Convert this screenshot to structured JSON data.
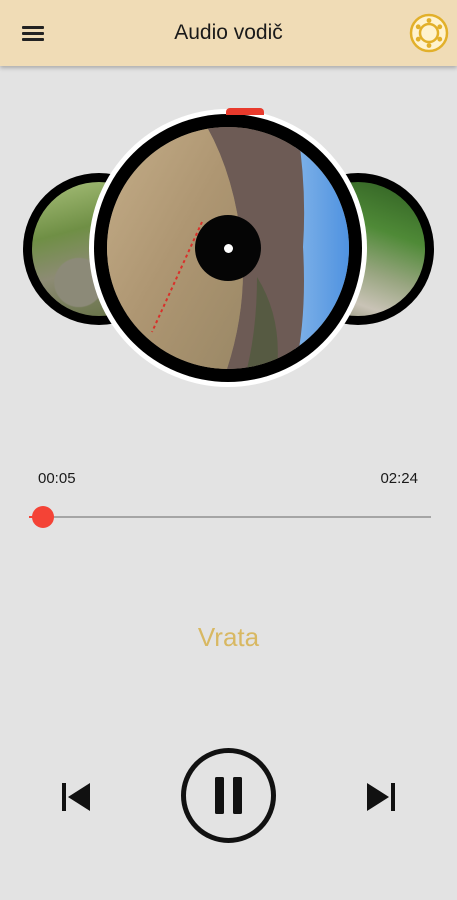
{
  "header": {
    "title": "Audio vodič"
  },
  "player": {
    "current_time": "00:05",
    "total_time": "02:24",
    "progress_fraction": 0.035,
    "track_title": "Vrata",
    "state": "playing"
  },
  "icons": {
    "menu": "hamburger-menu-icon",
    "logo": "brand-logo-icon",
    "previous": "skip-previous-icon",
    "pause": "pause-icon",
    "next": "skip-next-icon"
  },
  "colors": {
    "header_bg": "#f0dcb6",
    "accent": "#f44336",
    "track_title": "#d8b862",
    "logo": "#e2b02a"
  }
}
